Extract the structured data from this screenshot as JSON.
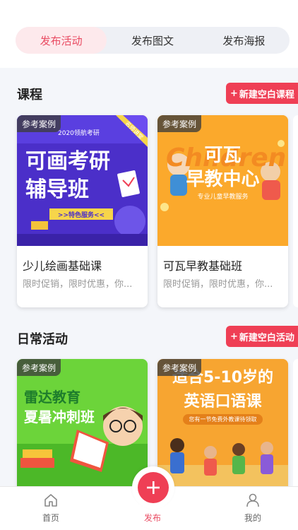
{
  "tabs": [
    {
      "label": "发布活动",
      "active": true
    },
    {
      "label": "发布图文",
      "active": false
    },
    {
      "label": "发布海报",
      "active": false
    }
  ],
  "sections": {
    "course": {
      "title": "课程",
      "new_button": "新建空白课程",
      "cards": [
        {
          "badge": "参考案例",
          "name": "少儿绘画基础课",
          "desc": "限时促销，限时优惠，你...",
          "poster": {
            "top_line": "2020领航考研",
            "corner": "名师讲堂",
            "title_1": "可画考研",
            "title_2": "辅导班",
            "button": ">>特色服务<<"
          }
        },
        {
          "badge": "参考案例",
          "name": "可瓦早教基础班",
          "desc": "限时促销，限时优惠，你...",
          "poster": {
            "deco": "Children",
            "title_1": "可瓦",
            "title_2": "早教中心",
            "sub": "专业儿童早教服务"
          }
        }
      ]
    },
    "activity": {
      "title": "日常活动",
      "new_button": "新建空白活动",
      "cards": [
        {
          "badge": "参考案例",
          "poster": {
            "title_1": "雷达教育",
            "title_2": "夏暑冲刺班"
          }
        },
        {
          "badge": "参考案例",
          "poster": {
            "title_1": "适合5-10岁的",
            "title_2": "英语口语课",
            "sub": "您有一节免费外教课待领取"
          }
        }
      ]
    }
  },
  "bottom_nav": {
    "home": "首页",
    "publish": "发布",
    "mine": "我的"
  },
  "colors": {
    "accent": "#ef3f55",
    "tab_active_bg": "#fde9ec",
    "card1_bg": "#4b2fc9",
    "card2_bg": "#fba92c",
    "card3_bg": "#6cd43a",
    "card4_bg": "#f7a531"
  },
  "icons": {
    "home": "home-icon",
    "publish": "plus-icon",
    "mine": "user-icon"
  }
}
